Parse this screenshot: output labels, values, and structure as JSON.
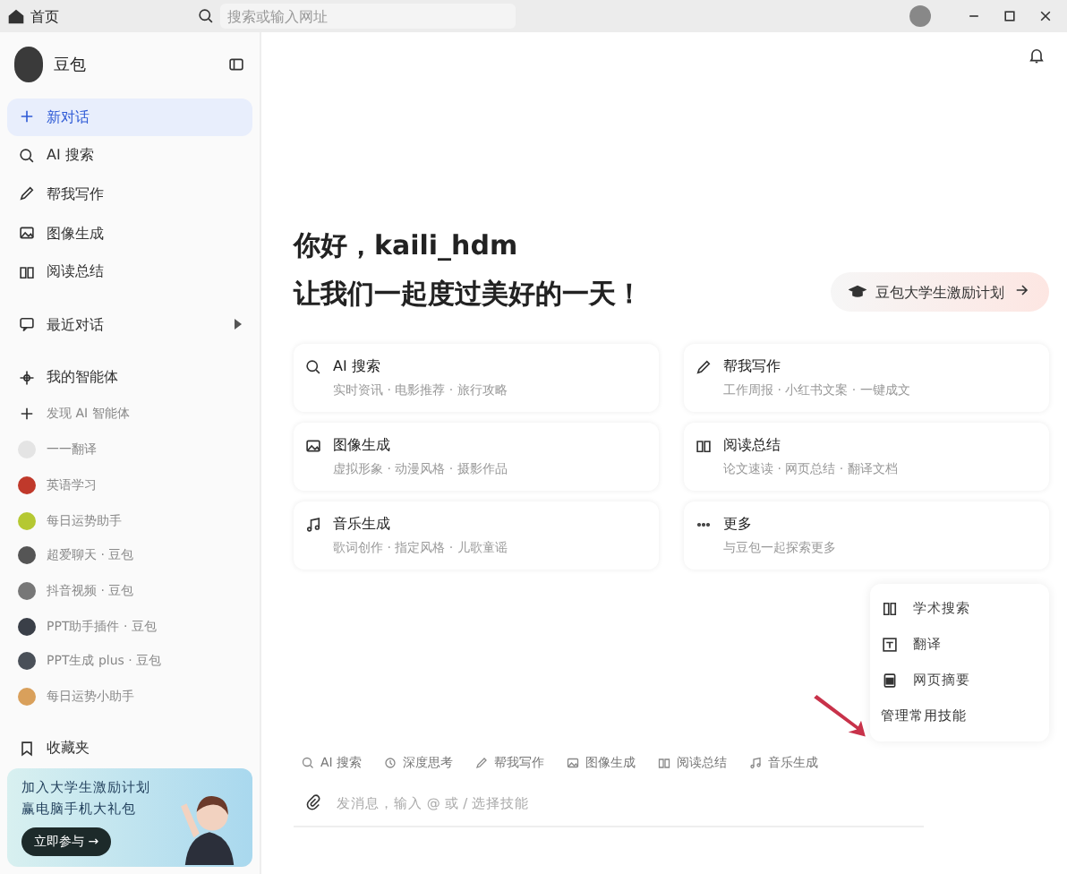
{
  "titlebar": {
    "home": "首页",
    "search_placeholder": "搜索或输入网址"
  },
  "sidebar": {
    "app_name": "豆包",
    "nav": [
      {
        "kind": "new",
        "label": "新对话",
        "selected": true
      },
      {
        "kind": "search",
        "label": "AI 搜索",
        "selected": false
      },
      {
        "kind": "write",
        "label": "帮我写作",
        "selected": false
      },
      {
        "kind": "image",
        "label": "图像生成",
        "selected": false
      },
      {
        "kind": "read",
        "label": "阅读总结",
        "selected": false
      }
    ],
    "recent": {
      "label": "最近对话",
      "expanded": false
    },
    "agents": {
      "label": "我的智能体",
      "items": [
        {
          "kind": "plus",
          "label": "发现 AI 智能体"
        },
        {
          "kind": "blank",
          "label": "一一翻译"
        },
        {
          "kind": "avatar",
          "color": "#c0392b",
          "label": "英语学习"
        },
        {
          "kind": "avatar",
          "color": "#b5c832",
          "label": "每日运势助手"
        },
        {
          "kind": "avatar",
          "color": "#555555",
          "label": "超爱聊天 · 豆包"
        },
        {
          "kind": "avatar",
          "color": "#777777",
          "label": "抖音视频 · 豆包"
        },
        {
          "kind": "avatar",
          "color": "#3a3f48",
          "label": "PPT助手插件 · 豆包"
        },
        {
          "kind": "avatar",
          "color": "#4a5058",
          "label": "PPT生成 plus · 豆包"
        },
        {
          "kind": "avatar",
          "color": "#d9a05b",
          "label": "每日运势小助手"
        }
      ]
    },
    "favorites": "收藏夹",
    "promo": {
      "line1": "加入大学生激励计划",
      "line2": "赢电脑手机大礼包",
      "button": "立即参与 →"
    }
  },
  "greeting": {
    "line1": "你好，kaili_hdm",
    "line2": "让我们一起度过美好的一天！"
  },
  "promo_badge": "豆包大学生激励计划",
  "cards": [
    {
      "kind": "search",
      "title": "AI 搜索",
      "subtitle": "实时资讯 · 电影推荐 · 旅行攻略"
    },
    {
      "kind": "write",
      "title": "帮我写作",
      "subtitle": "工作周报 · 小红书文案 · 一键成文"
    },
    {
      "kind": "image",
      "title": "图像生成",
      "subtitle": "虚拟形象 · 动漫风格 · 摄影作品"
    },
    {
      "kind": "read",
      "title": "阅读总结",
      "subtitle": "论文速读 · 网页总结 · 翻译文档"
    },
    {
      "kind": "music",
      "title": "音乐生成",
      "subtitle": "歌词创作 · 指定风格 · 儿歌童谣"
    },
    {
      "kind": "more",
      "title": "更多",
      "subtitle": "与豆包一起探索更多"
    }
  ],
  "skill_menu": {
    "items": [
      {
        "kind": "book",
        "label": "学术搜索"
      },
      {
        "kind": "translate",
        "label": "翻译"
      },
      {
        "kind": "page",
        "label": "网页摘要"
      }
    ],
    "manage": "管理常用技能"
  },
  "toolbar": [
    {
      "kind": "search",
      "label": "AI 搜索"
    },
    {
      "kind": "think",
      "label": "深度思考"
    },
    {
      "kind": "write",
      "label": "帮我写作"
    },
    {
      "kind": "image",
      "label": "图像生成"
    },
    {
      "kind": "read",
      "label": "阅读总结"
    },
    {
      "kind": "music",
      "label": "音乐生成"
    }
  ],
  "input": {
    "placeholder": "发消息，输入 @ 或 / 选择技能"
  }
}
